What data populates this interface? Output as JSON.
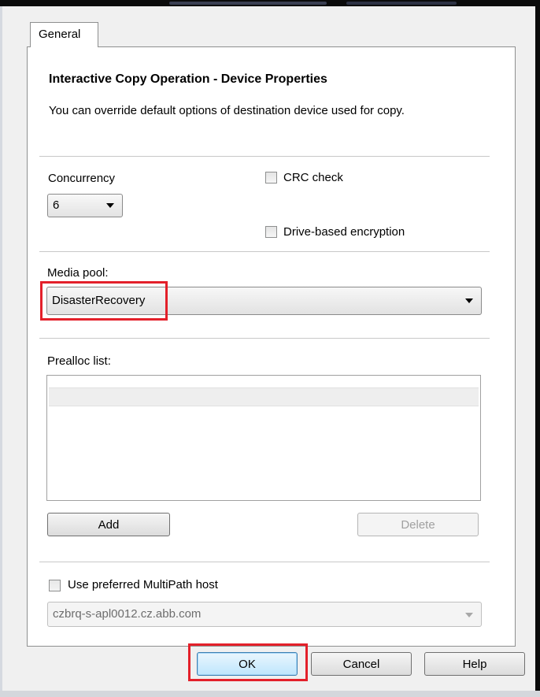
{
  "tab": {
    "label": "General"
  },
  "heading": "Interactive Copy Operation - Device Properties",
  "description": "You can override default options of destination device used for copy.",
  "concurrency": {
    "label": "Concurrency",
    "value": "6"
  },
  "crc_check": {
    "label": "CRC check",
    "checked": false
  },
  "drive_encryption": {
    "label": "Drive-based encryption",
    "checked": false
  },
  "media_pool": {
    "label": "Media pool:",
    "value": "DisasterRecovery"
  },
  "prealloc": {
    "label": "Prealloc list:",
    "items": []
  },
  "buttons": {
    "add": "Add",
    "delete": "Delete",
    "ok": "OK",
    "cancel": "Cancel",
    "help": "Help"
  },
  "multipath": {
    "checkbox_label": "Use preferred MultiPath host",
    "checked": false,
    "host_value": "czbrq-s-apl0012.cz.abb.com"
  },
  "colors": {
    "highlight": "#e3202a",
    "ok_button": "#bee6fd"
  }
}
